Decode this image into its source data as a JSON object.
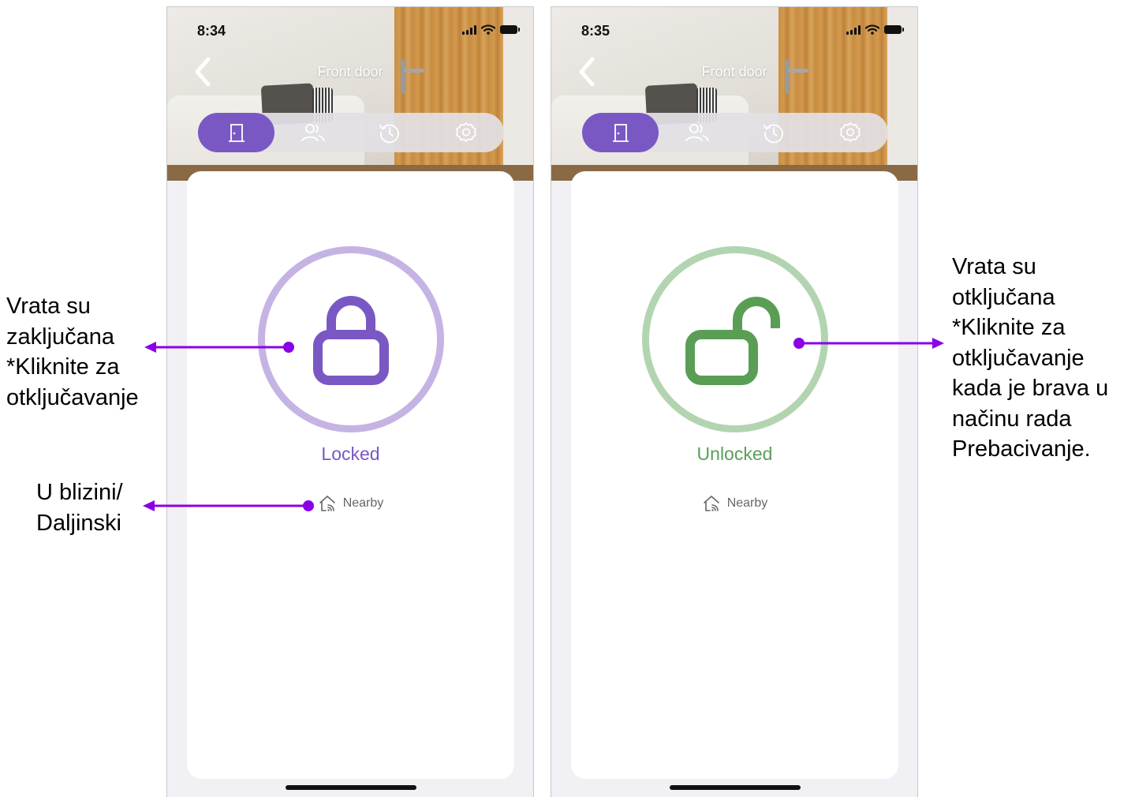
{
  "colors": {
    "locked_accent": "#7a58c4",
    "locked_ring": "#c5b4e3",
    "unlocked_accent": "#5a9e56",
    "unlocked_ring": "#b3d4b1",
    "annotation_arrow": "#8a00e6"
  },
  "screens": [
    {
      "status_time": "8:34",
      "title": "Front door",
      "tabs": [
        {
          "icon": "door-icon",
          "active": true
        },
        {
          "icon": "users-icon",
          "active": false
        },
        {
          "icon": "history-icon",
          "active": false
        },
        {
          "icon": "gear-icon",
          "active": false
        }
      ],
      "lock_state": "Locked",
      "lock_icon": "padlock-closed-icon",
      "nearby_label": "Nearby",
      "nearby_icon": "home-signal-icon"
    },
    {
      "status_time": "8:35",
      "title": "Front door",
      "tabs": [
        {
          "icon": "door-icon",
          "active": true
        },
        {
          "icon": "users-icon",
          "active": false
        },
        {
          "icon": "history-icon",
          "active": false
        },
        {
          "icon": "gear-icon",
          "active": false
        }
      ],
      "lock_state": "Unlocked",
      "lock_icon": "padlock-open-icon",
      "nearby_label": "Nearby",
      "nearby_icon": "home-signal-icon"
    }
  ],
  "annotations": {
    "locked": [
      "Vrata su",
      "zaključana",
      "*Kliknite za",
      "otključavanje"
    ],
    "nearby": [
      "U blizini/",
      "Daljinski"
    ],
    "unlocked": [
      "Vrata su",
      "otključana",
      "*Kliknite za",
      "otključavanje",
      "kada je brava u",
      "načinu rada",
      "Prebacivanje."
    ]
  }
}
